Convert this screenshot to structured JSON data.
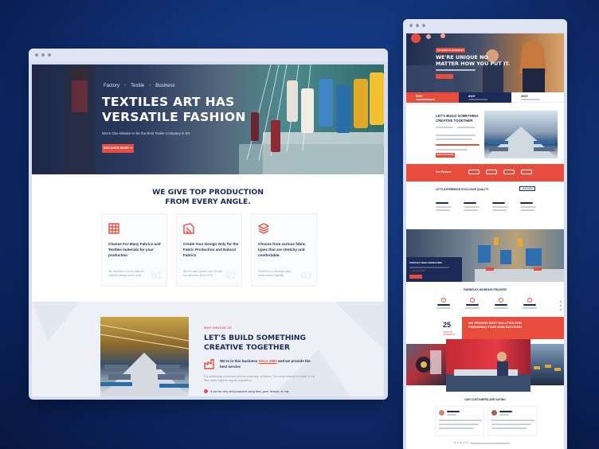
{
  "left": {
    "hero": {
      "breadcrumbs": [
        "Factory",
        "Textile",
        "Business"
      ],
      "title_line1": "TEXTILES ART HAS",
      "title_line2": "VERSATILE FASHION",
      "subtitle": "We're One Mission to be the Best Textile Company in NY.",
      "cta": "DISCOVER MORE ➜"
    },
    "features": {
      "heading_line1": "WE GIVE TOP PRODUCTION",
      "heading_line2": "FROM EVERY ANGLE.",
      "cards": [
        {
          "title": "Choose For Many Fabrics and Textiles materials for your production",
          "desc": "We classified it on the basis of material, design and its craft.",
          "num": "01",
          "icon": "fabric-swatch-icon"
        },
        {
          "title": "Create Your Design Only for the Fabric Production and Natural Fabrics",
          "desc": "With its rapid growth over the last four decades, since 1975",
          "num": "02",
          "icon": "fabric-roll-icon"
        },
        {
          "title": "Choose from various fabric types that are stretchy and comfortable.",
          "desc": "FabriFlex is a leading expert textile service globally.",
          "num": "03",
          "icon": "fabric-stack-icon"
        }
      ]
    },
    "about": {
      "tag": "WHY CHOOSE US",
      "heading_line1": "LET'S BUILD SOMETHING",
      "heading_line2": "CREATIVE TOGETHER",
      "highlight_pre": "We're in this business ",
      "highlight_link": "Since 1987",
      "highlight_post": " and we provide the best service",
      "paragraph": "It is additionally connected with the production of clothes. The crude material of textiles in the fiber which might be regular engineered.",
      "bullet": "It can be very well produced using fiber, yarn, texture, or mix."
    }
  },
  "right": {
    "hero": {
      "tag": "FASHION IN BUSINESS",
      "title_line1": "WE'RE UNIQUE NO",
      "title_line2": "MATTER HOW YOU PUT IT."
    },
    "stats": [
      {
        "value": "580+"
      },
      {
        "value": "840+"
      },
      {
        "value": "490+"
      }
    ],
    "build": {
      "heading_line1": "LET'S BUILD SOMETHING",
      "heading_line2": "CREATIVE TOGETHER",
      "cta": "DISCOVER MORE"
    },
    "partners": {
      "label": "Our Partners"
    },
    "quality": {
      "heading": "LET'S EXPERIENCE EXCLUSIVE QUALITY",
      "button": "VIEW MORE"
    },
    "consult": {
      "heading_line1": "CONTACT FREE CONSULTING",
      "phone": "+1 (234) 567 890"
    },
    "process": {
      "heading": "FABRIFLEX WORKING PROCESS"
    },
    "solution": {
      "number": "25",
      "years_text": "YEARS OF EXPERIENCE",
      "heading_line1": "WE PROVIDE BEST SOLUTION FOR",
      "heading_line2": "PREPARING YOUR OWN SUCCESS!"
    },
    "testimonials": {
      "heading": "OUR CUSTOMERS ARE SAYING"
    }
  },
  "colors": {
    "accent": "#e74c3c",
    "navy": "#1b2a56",
    "bg": "#123479"
  }
}
